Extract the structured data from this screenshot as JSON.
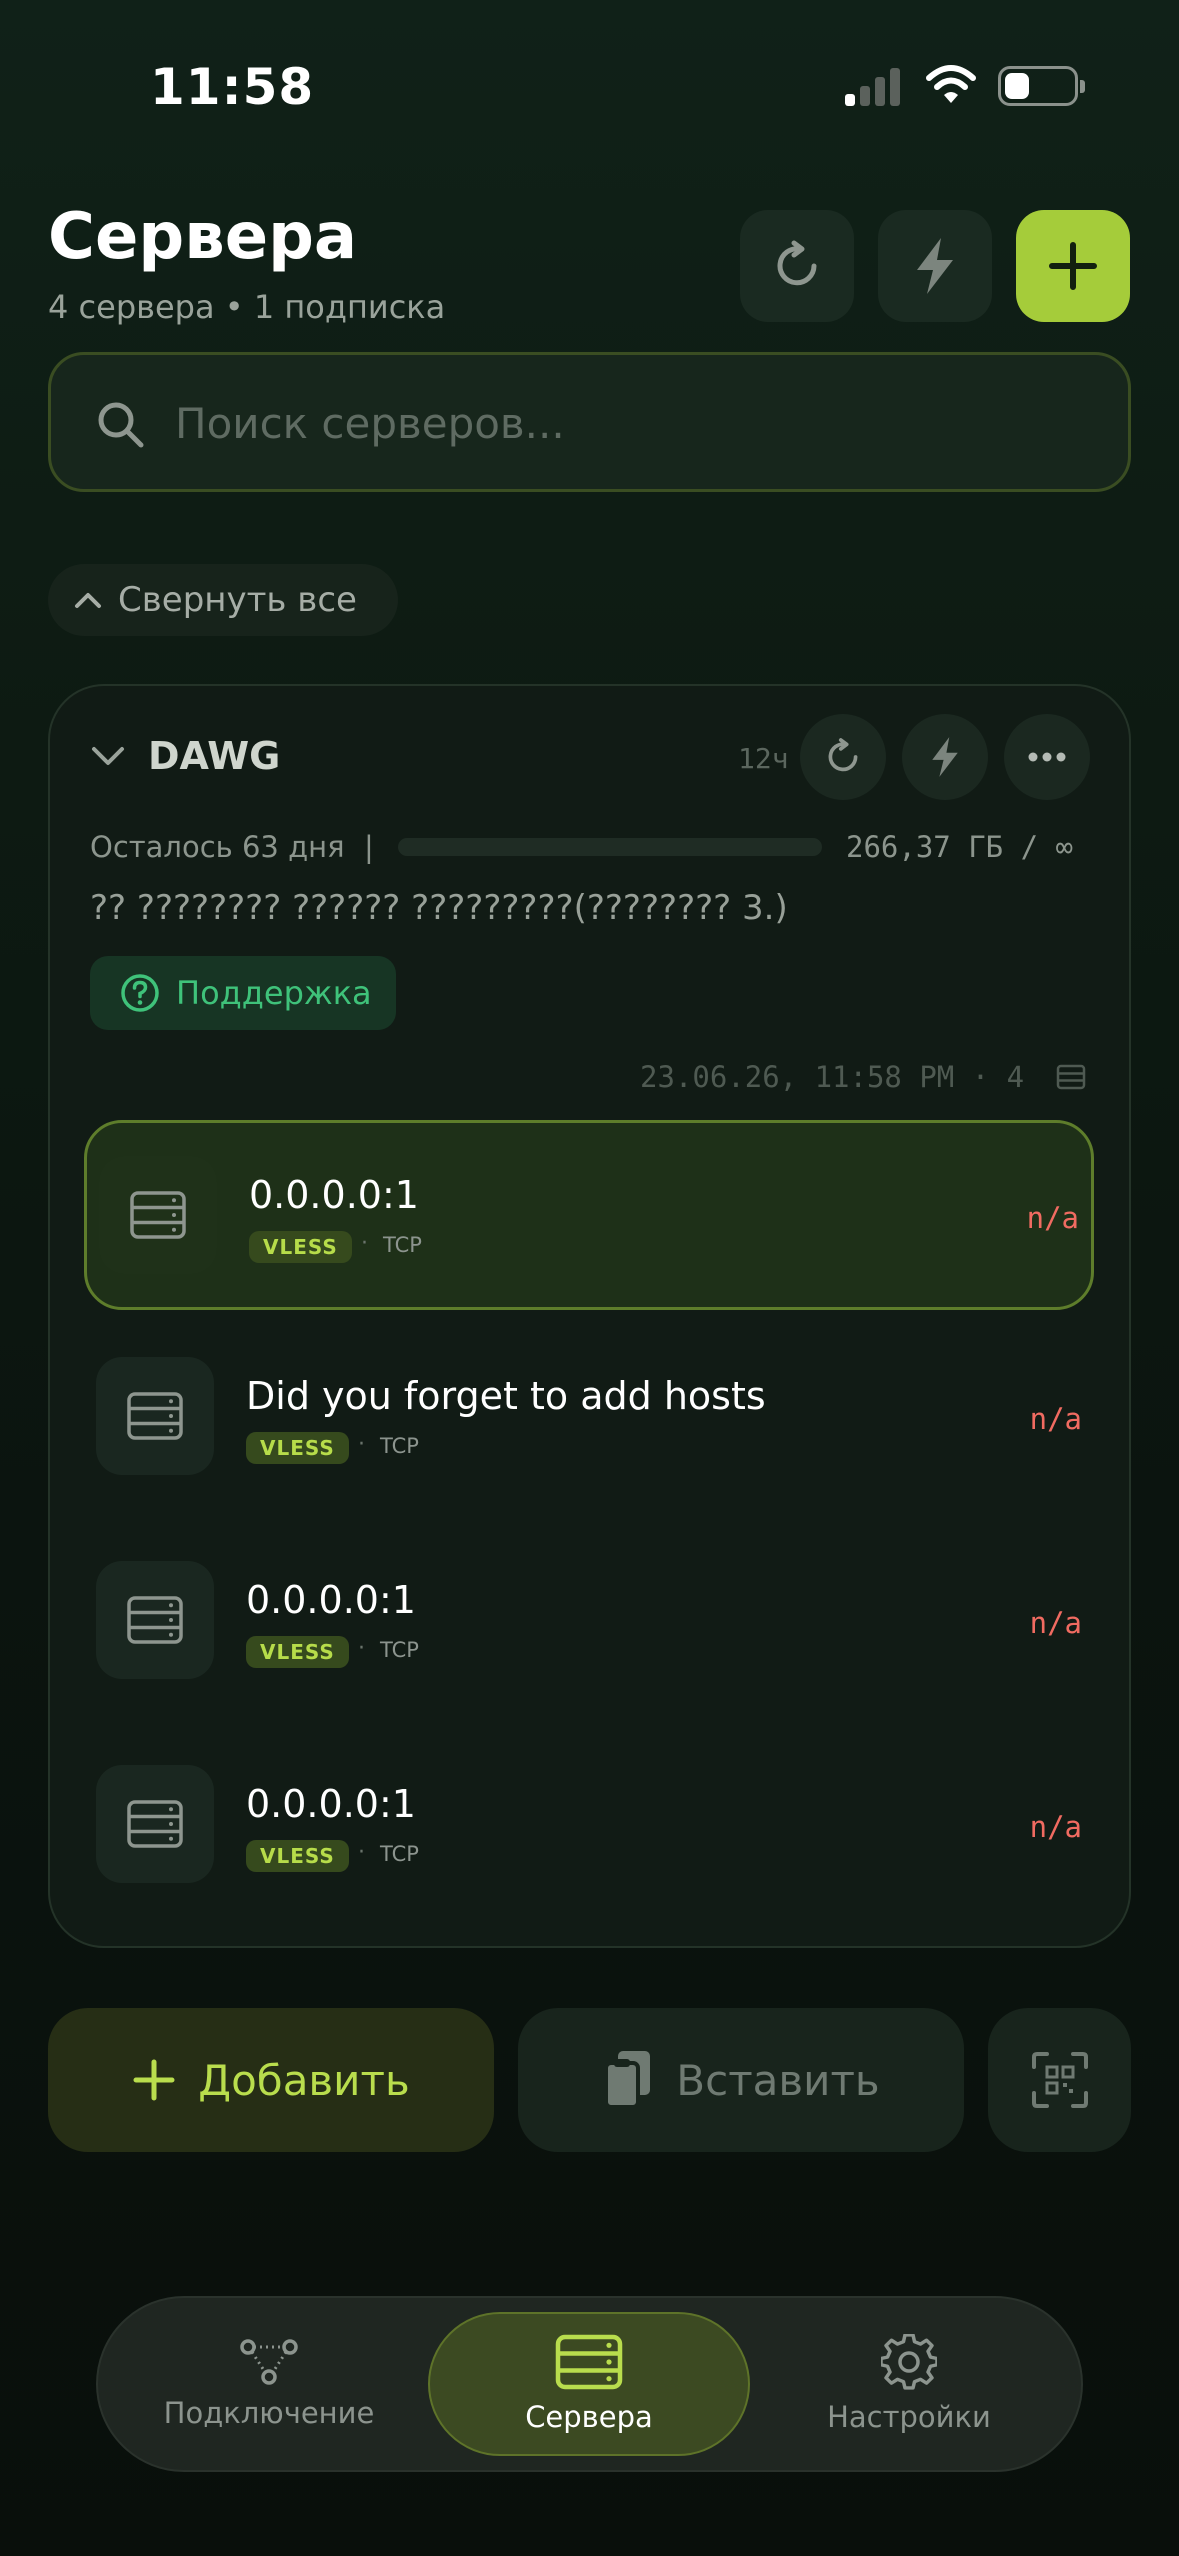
{
  "status_bar": {
    "time": "11:58"
  },
  "header": {
    "title": "Сервера",
    "subtitle": "4 сервера • 1 подписка"
  },
  "search": {
    "placeholder": "Поиск серверов..."
  },
  "collapse_all_label": "Свернуть все",
  "group": {
    "name": "DAWG",
    "updated": "12ч",
    "remaining": "Осталось 63 дня",
    "separator": "|",
    "traffic": "266,37 ГБ / ∞",
    "usage_fraction": 0.0,
    "description": "?? ???????? ?????? ?????????(???????? 3.)",
    "support_label": "Поддержка",
    "meta": "23.06.26, 11:58 PM · 4"
  },
  "servers": [
    {
      "name": "0.0.0.0:1",
      "badge": "VLESS",
      "dot": "·",
      "protocol": "TCP",
      "ping": "n/a",
      "active": true
    },
    {
      "name": "Did you forget to add hosts",
      "badge": "VLESS",
      "dot": "·",
      "protocol": "TCP",
      "ping": "n/a",
      "active": false
    },
    {
      "name": "0.0.0.0:1",
      "badge": "VLESS",
      "dot": "·",
      "protocol": "TCP",
      "ping": "n/a",
      "active": false
    },
    {
      "name": "0.0.0.0:1",
      "badge": "VLESS",
      "dot": "·",
      "protocol": "TCP",
      "ping": "n/a",
      "active": false
    }
  ],
  "actions": {
    "add_label": "Добавить",
    "paste_label": "Вставить"
  },
  "tabs": [
    {
      "label": "Подключение",
      "icon": "nodes-icon"
    },
    {
      "label": "Сервера",
      "icon": "servers-icon",
      "active": true
    },
    {
      "label": "Настройки",
      "icon": "gear-icon"
    }
  ],
  "colors": {
    "accent": "#a5cc3a",
    "background": "#0d1a12",
    "ping_error": "#f06b61",
    "support": "#3fc27a"
  }
}
